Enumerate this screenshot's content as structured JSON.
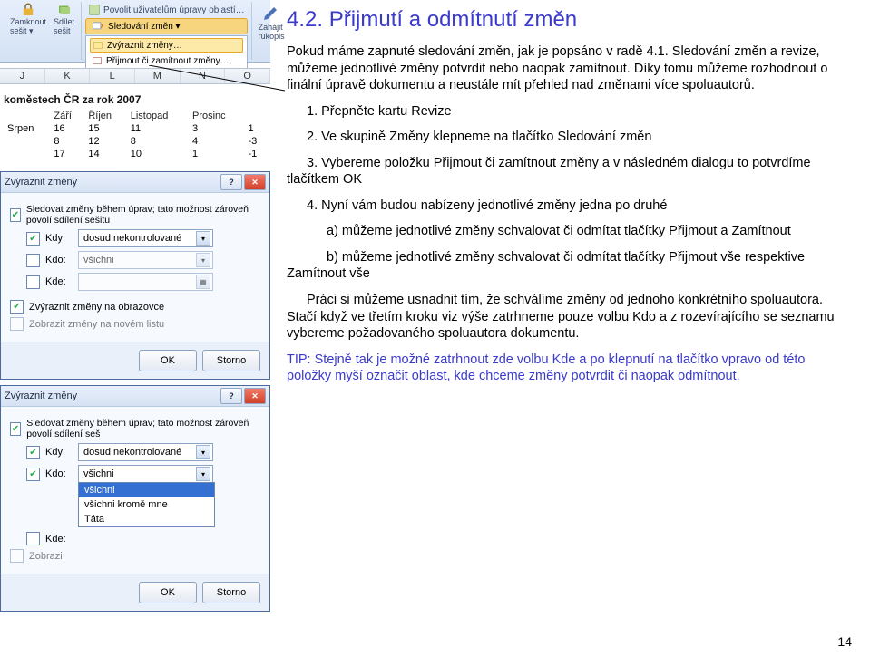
{
  "ribbon": {
    "lock": "nout",
    "close_label": "Zamknout\nsešit ▾",
    "share_label": "Sdílet\nsešit",
    "allow_edit": "Povolit uživatelům úpravy oblastí…",
    "track_label": "Sledování změn ▾",
    "menu_highlight": "Zvýraznit změny…",
    "menu_accept": "Přijmout či zamítnout změny…",
    "start_label": "Zahájit\nrukopis"
  },
  "letters": [
    "J",
    "K",
    "L",
    "M",
    "N",
    "O"
  ],
  "sheet": {
    "title": "koměstech ČR za rok 2007",
    "cols": [
      "",
      "Září",
      "Říjen",
      "Listopad",
      "Prosinc"
    ],
    "rows": [
      [
        "Srpen",
        "16",
        "15",
        "11",
        "3",
        "1"
      ],
      [
        "",
        "8",
        "12",
        "8",
        "4",
        "-3"
      ],
      [
        "",
        "17",
        "14",
        "10",
        "1",
        "-1"
      ]
    ]
  },
  "dlg1": {
    "title": "Zvýraznit změny",
    "tracklabel": "Sledovat změny během úprav; tato možnost zároveň povolí sdílení sešitu",
    "kdy_lbl": "Kdy:",
    "kdy_val": "dosud nekontrolované",
    "kdo_lbl": "Kdo:",
    "kdo_val": "všichni",
    "kde_lbl": "Kde:",
    "onscreen": "Zvýraznit změny na obrazovce",
    "newsheet": "Zobrazit změny na novém listu",
    "ok": "OK",
    "cancel": "Storno"
  },
  "dlg2": {
    "title": "Zvýraznit změny",
    "tracklabel": "Sledovat změny během úprav; tato možnost zároveň povolí sdílení seš",
    "kdy_lbl": "Kdy:",
    "kdy_val": "dosud nekontrolované",
    "kdo_lbl": "Kdo:",
    "kdo_val": "všichni",
    "options": [
      "všichni",
      "všichni kromě mne",
      "Táta"
    ],
    "kde_lbl": "Kde:",
    "zobraz": "Zobrazi",
    "ok": "OK",
    "cancel": "Storno"
  },
  "doc": {
    "heading": "4.2. Přijmutí a odmítnutí změn",
    "p1": "Pokud máme zapnuté sledování změn, jak je popsáno v radě 4.1. Sledování změn a revize, můžeme jednotlivé změny potvrdit  nebo naopak zamítnout. Díky tomu můžeme rozhodnout o finální úpravě dokumentu a neustále mít přehled nad změnami více spoluautorů.",
    "s1": "1. Přepněte kartu Revize",
    "s2": "2. Ve skupině Změny klepneme na tlačítko Sledování změn",
    "s3": "3. Vybereme položku Přijmout či zamítnout změny a v následném dialogu to potvrdíme tlačítkem OK",
    "s4": "4. Nyní vám budou nabízeny jednotlivé změny jedna po druhé",
    "s4a": "a) můžeme jednotlivé změny schvalovat či odmítat tlačítky Přijmout a Zamítnout",
    "s4b": "b) můžeme jednotlivé změny schvalovat či odmítat tlačítky Přijmout vše respektive Zamítnout vše",
    "p2": "Práci si můžeme usnadnit tím, že schválíme změny od jednoho konkrétního spoluautora. Stačí když ve třetím kroku viz výše zatrhneme pouze volbu Kdo a z rozevírajícího se seznamu vybereme požadovaného spoluautora dokumentu.",
    "tip": "TIP: Stejně tak je možné zatrhnout zde volbu Kde a po klepnutí na tlačítko vpravo od této položky myší označit oblast, kde chceme změny potvrdit či naopak odmítnout.",
    "pagenum": "14"
  }
}
